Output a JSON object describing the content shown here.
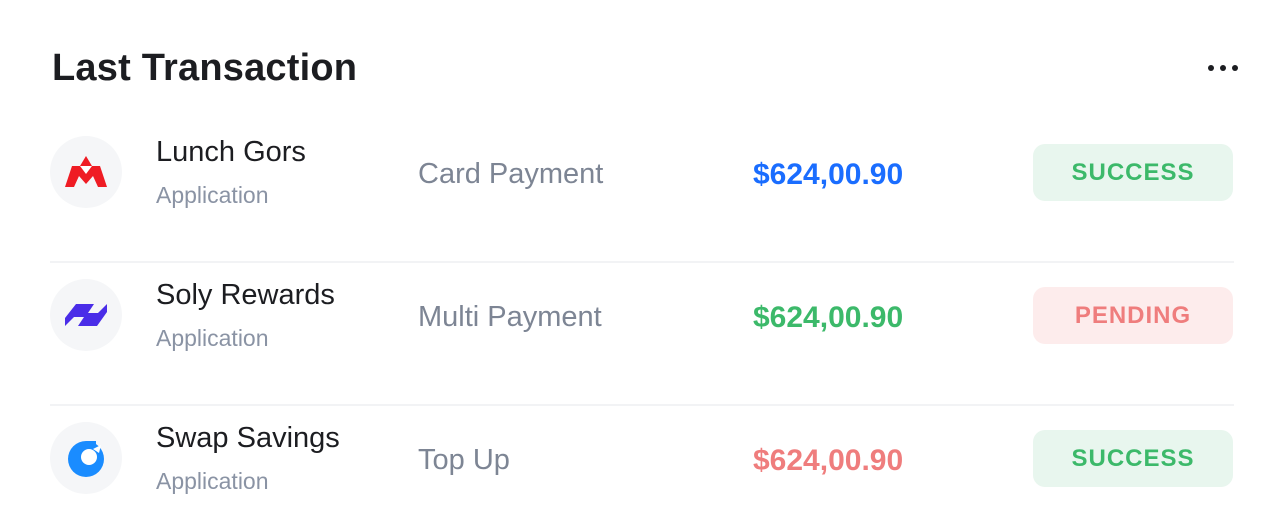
{
  "header": {
    "title": "Last Transaction"
  },
  "colors": {
    "blue": "#1a6dff",
    "green": "#3cb96a",
    "red": "#ef7d7d",
    "success_bg": "#e8f6ee",
    "pending_bg": "#fdecec"
  },
  "transactions": [
    {
      "name": "Lunch Gors",
      "category": "Application",
      "type": "Card Payment",
      "amount": "$624,00.90",
      "amount_color": "#1a6dff",
      "status": "SUCCESS",
      "icon": "lunch-gors-logo-icon"
    },
    {
      "name": "Soly Rewards",
      "category": "Application",
      "type": "Multi Payment",
      "amount": "$624,00.90",
      "amount_color": "#3cb96a",
      "status": "PENDING",
      "icon": "soly-rewards-logo-icon"
    },
    {
      "name": "Swap Savings",
      "category": "Application",
      "type": "Top Up",
      "amount": "$624,00.90",
      "amount_color": "#ef7d7d",
      "status": "SUCCESS",
      "icon": "swap-savings-logo-icon"
    }
  ]
}
